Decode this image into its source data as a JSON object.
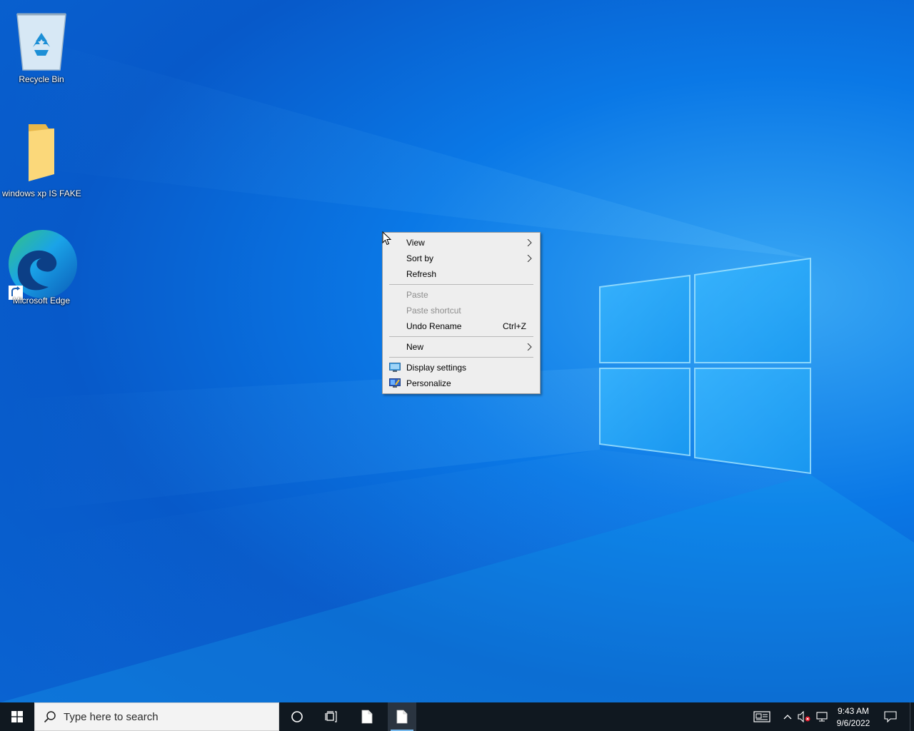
{
  "desktop": {
    "icons": [
      {
        "label": "Recycle Bin",
        "icon": "recycle-bin-icon"
      },
      {
        "label": "windows xp IS FAKE",
        "icon": "folder-icon"
      },
      {
        "label": "Microsoft Edge",
        "icon": "edge-icon"
      }
    ]
  },
  "context_menu": {
    "items": [
      {
        "label": "View",
        "submenu": true
      },
      {
        "label": "Sort by",
        "submenu": true
      },
      {
        "label": "Refresh"
      },
      {
        "label": "Paste",
        "disabled": true
      },
      {
        "label": "Paste shortcut",
        "disabled": true
      },
      {
        "label": "Undo Rename",
        "shortcut": "Ctrl+Z"
      },
      {
        "label": "New",
        "submenu": true
      },
      {
        "label": "Display settings",
        "icon": "display-settings-icon"
      },
      {
        "label": "Personalize",
        "icon": "personalize-icon"
      }
    ]
  },
  "taskbar": {
    "search_placeholder": "Type here to search",
    "clock": {
      "time": "9:43 AM",
      "date": "9/6/2022"
    },
    "icons": [
      "windows-start-icon",
      "search-icon",
      "cortana-icon",
      "task-view-icon",
      "file-icon",
      "news-icon",
      "chevron-up-icon",
      "volume-muted-icon",
      "network-icon",
      "notification-icon"
    ]
  },
  "colors": {
    "taskbar": "#101820",
    "menu_background": "#eeeeee",
    "active_underline": "#76b9ed"
  }
}
